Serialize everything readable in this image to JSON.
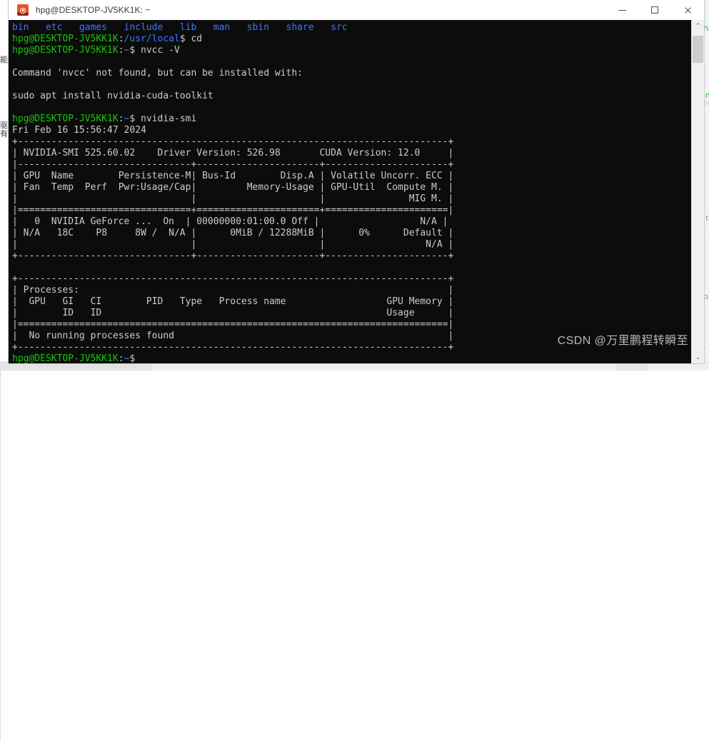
{
  "window": {
    "title": "hpg@DESKTOP-JV5KK1K: ~",
    "icon": "ubuntu-icon",
    "controls": {
      "minimize_label": "Minimize",
      "maximize_label": "Maximize",
      "close_label": "Close"
    }
  },
  "scrollbar": {
    "up_arrow": "⌃",
    "down_arrow": "⌄"
  },
  "watermark": {
    "text": "CSDN @万里鹏程转瞬至"
  },
  "colors": {
    "background": "#0c0c0c",
    "foreground": "#cccccc",
    "prompt_green": "#16c60c",
    "dir_blue": "#3b78ff",
    "titlebar": "#ffffff",
    "icon_orange": "#e0491d"
  },
  "terminal": {
    "user_host": "hpg@DESKTOP-JV5KK1K",
    "lines": [
      {
        "segments": [
          {
            "t": "bin   etc   games   include   lib   man   sbin   share   src",
            "c": "blue"
          }
        ]
      },
      {
        "segments": [
          {
            "t": "hpg@DESKTOP-JV5KK1K",
            "c": "green"
          },
          {
            "t": ":",
            "c": "white"
          },
          {
            "t": "/usr/local",
            "c": "blue"
          },
          {
            "t": "$ cd",
            "c": "white"
          }
        ]
      },
      {
        "segments": [
          {
            "t": "hpg@DESKTOP-JV5KK1K",
            "c": "green"
          },
          {
            "t": ":",
            "c": "white"
          },
          {
            "t": "~",
            "c": "blue"
          },
          {
            "t": "$ nvcc -V",
            "c": "white"
          }
        ]
      },
      {
        "segments": [
          {
            "t": "",
            "c": "white"
          }
        ]
      },
      {
        "segments": [
          {
            "t": "Command 'nvcc' not found, but can be installed with:",
            "c": "white"
          }
        ]
      },
      {
        "segments": [
          {
            "t": "",
            "c": "white"
          }
        ]
      },
      {
        "segments": [
          {
            "t": "sudo apt install nvidia-cuda-toolkit",
            "c": "white"
          }
        ]
      },
      {
        "segments": [
          {
            "t": "",
            "c": "white"
          }
        ]
      },
      {
        "segments": [
          {
            "t": "hpg@DESKTOP-JV5KK1K",
            "c": "green"
          },
          {
            "t": ":",
            "c": "white"
          },
          {
            "t": "~",
            "c": "blue"
          },
          {
            "t": "$ nvidia-smi",
            "c": "white"
          }
        ]
      },
      {
        "segments": [
          {
            "t": "Fri Feb 16 15:56:47 2024",
            "c": "white"
          }
        ]
      },
      {
        "segments": [
          {
            "t": "+-----------------------------------------------------------------------------+",
            "c": "white"
          }
        ]
      },
      {
        "segments": [
          {
            "t": "| NVIDIA-SMI 525.60.02    Driver Version: 526.98       CUDA Version: 12.0     |",
            "c": "white"
          }
        ]
      },
      {
        "segments": [
          {
            "t": "|-------------------------------+----------------------+----------------------+",
            "c": "white"
          }
        ]
      },
      {
        "segments": [
          {
            "t": "| GPU  Name        Persistence-M| Bus-Id        Disp.A | Volatile Uncorr. ECC |",
            "c": "white"
          }
        ]
      },
      {
        "segments": [
          {
            "t": "| Fan  Temp  Perf  Pwr:Usage/Cap|         Memory-Usage | GPU-Util  Compute M. |",
            "c": "white"
          }
        ]
      },
      {
        "segments": [
          {
            "t": "|                               |                      |               MIG M. |",
            "c": "white"
          }
        ]
      },
      {
        "segments": [
          {
            "t": "|===============================+======================+======================|",
            "c": "white"
          }
        ]
      },
      {
        "segments": [
          {
            "t": "|   0  NVIDIA GeForce ...  On  | 00000000:01:00.0 Off |                  N/A |",
            "c": "white"
          }
        ]
      },
      {
        "segments": [
          {
            "t": "| N/A   18C    P8     8W /  N/A |      0MiB / 12288MiB |      0%      Default |",
            "c": "white"
          }
        ]
      },
      {
        "segments": [
          {
            "t": "|                               |                      |                  N/A |",
            "c": "white"
          }
        ]
      },
      {
        "segments": [
          {
            "t": "+-------------------------------+----------------------+----------------------+",
            "c": "white"
          }
        ]
      },
      {
        "segments": [
          {
            "t": "",
            "c": "white"
          }
        ]
      },
      {
        "segments": [
          {
            "t": "+-----------------------------------------------------------------------------+",
            "c": "white"
          }
        ]
      },
      {
        "segments": [
          {
            "t": "| Processes:                                                                  |",
            "c": "white"
          }
        ]
      },
      {
        "segments": [
          {
            "t": "|  GPU   GI   CI        PID   Type   Process name                  GPU Memory |",
            "c": "white"
          }
        ]
      },
      {
        "segments": [
          {
            "t": "|        ID   ID                                                   Usage      |",
            "c": "white"
          }
        ]
      },
      {
        "segments": [
          {
            "t": "|=============================================================================|",
            "c": "white"
          }
        ]
      },
      {
        "segments": [
          {
            "t": "|  No running processes found                                                 |",
            "c": "white"
          }
        ]
      },
      {
        "segments": [
          {
            "t": "+-----------------------------------------------------------------------------+",
            "c": "white"
          }
        ]
      },
      {
        "segments": [
          {
            "t": "hpg@DESKTOP-JV5KK1K",
            "c": "green"
          },
          {
            "t": ":",
            "c": "white"
          },
          {
            "t": "~",
            "c": "blue"
          },
          {
            "t": "$ ",
            "c": "white"
          }
        ]
      }
    ]
  },
  "nvidia_smi": {
    "timestamp": "Fri Feb 16 15:56:47 2024",
    "smi_version": "525.60.02",
    "driver_version": "526.98",
    "cuda_version": "12.0",
    "device_headers_row1": [
      "GPU",
      "Name",
      "Persistence-M",
      "Bus-Id",
      "Disp.A",
      "Volatile Uncorr. ECC"
    ],
    "device_headers_row2": [
      "Fan",
      "Temp",
      "Perf",
      "Pwr:Usage/Cap",
      "Memory-Usage",
      "GPU-Util",
      "Compute M."
    ],
    "device_headers_row3": [
      "MIG M."
    ],
    "devices": [
      {
        "index": "0",
        "name": "NVIDIA GeForce ...",
        "persistence_m": "On",
        "bus_id": "00000000:01:00.0",
        "disp_a": "Off",
        "ecc": "N/A",
        "fan": "N/A",
        "temp": "18C",
        "perf": "P8",
        "pwr_usage_cap": "8W /  N/A",
        "memory_usage": "0MiB / 12288MiB",
        "gpu_util": "0%",
        "compute_m": "Default",
        "mig_m": "N/A"
      }
    ],
    "processes_title": "Processes:",
    "processes_headers": [
      "GPU",
      "GI ID",
      "CI ID",
      "PID",
      "Type",
      "Process name",
      "GPU Memory Usage"
    ],
    "processes_empty_message": "No running processes found"
  },
  "commands_run": [
    "cd",
    "nvcc -V",
    "nvidia-smi"
  ],
  "ls_output": [
    "bin",
    "etc",
    "games",
    "include",
    "lib",
    "man",
    "sbin",
    "share",
    "src"
  ],
  "messages": {
    "nvcc_not_found": "Command 'nvcc' not found, but can be installed with:",
    "install_hint": "sudo apt install nvidia-cuda-toolkit"
  }
}
